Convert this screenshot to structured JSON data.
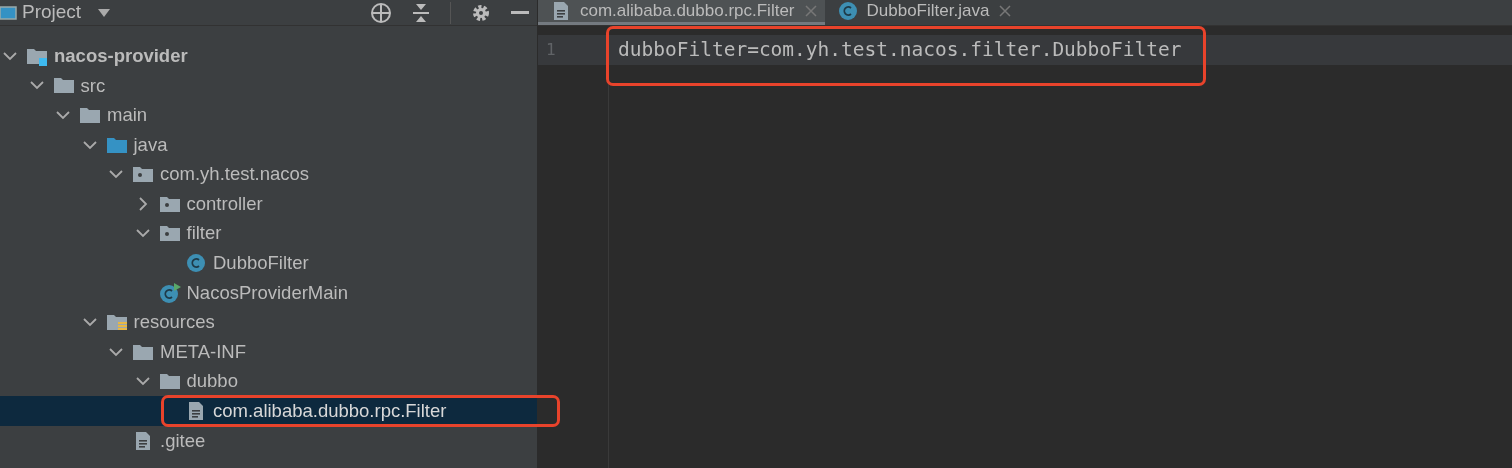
{
  "project_panel": {
    "title": "Project",
    "tree": [
      {
        "label": "nacos-provider",
        "kind": "module",
        "bold": true,
        "expanded": true,
        "selected": false,
        "highlighted": false,
        "children": [
          {
            "label": "src",
            "kind": "folder",
            "bold": false,
            "expanded": true,
            "selected": false,
            "highlighted": false,
            "children": [
              {
                "label": "main",
                "kind": "folder",
                "bold": false,
                "expanded": true,
                "selected": false,
                "highlighted": false,
                "children": [
                  {
                    "label": "java",
                    "kind": "source-folder",
                    "bold": false,
                    "expanded": true,
                    "selected": false,
                    "highlighted": false,
                    "children": [
                      {
                        "label": "com.yh.test.nacos",
                        "kind": "package",
                        "bold": false,
                        "expanded": true,
                        "selected": false,
                        "highlighted": false,
                        "children": [
                          {
                            "label": "controller",
                            "kind": "package",
                            "bold": false,
                            "expanded": false,
                            "selected": false,
                            "highlighted": false
                          },
                          {
                            "label": "filter",
                            "kind": "package",
                            "bold": false,
                            "expanded": true,
                            "selected": false,
                            "highlighted": false,
                            "children": [
                              {
                                "label": "DubboFilter",
                                "kind": "class",
                                "bold": false,
                                "selected": false,
                                "highlighted": false
                              }
                            ]
                          },
                          {
                            "label": "NacosProviderMain",
                            "kind": "main-class",
                            "bold": false,
                            "selected": false,
                            "highlighted": false
                          }
                        ]
                      }
                    ]
                  },
                  {
                    "label": "resources",
                    "kind": "resources",
                    "bold": false,
                    "expanded": true,
                    "selected": false,
                    "highlighted": false,
                    "children": [
                      {
                        "label": "META-INF",
                        "kind": "folder",
                        "bold": false,
                        "expanded": true,
                        "selected": false,
                        "highlighted": false,
                        "children": [
                          {
                            "label": "dubbo",
                            "kind": "folder",
                            "bold": false,
                            "expanded": true,
                            "selected": false,
                            "highlighted": false,
                            "children": [
                              {
                                "label": "com.alibaba.dubbo.rpc.Filter",
                                "kind": "file",
                                "bold": false,
                                "selected": true,
                                "highlighted": true
                              }
                            ]
                          }
                        ]
                      },
                      {
                        "label": ".gitee",
                        "kind": "file",
                        "bold": false,
                        "selected": false,
                        "highlighted": false
                      }
                    ]
                  }
                ]
              }
            ]
          }
        ]
      }
    ]
  },
  "editor": {
    "tabs": [
      {
        "label": "com.alibaba.dubbo.rpc.Filter",
        "kind": "file",
        "selected": true
      },
      {
        "label": "DubboFilter.java",
        "kind": "class",
        "selected": false
      }
    ],
    "lines": [
      {
        "number": "1",
        "text": "dubboFilter=com.yh.test.nacos.filter.DubboFilter",
        "current": true,
        "highlighted": true
      }
    ]
  }
}
